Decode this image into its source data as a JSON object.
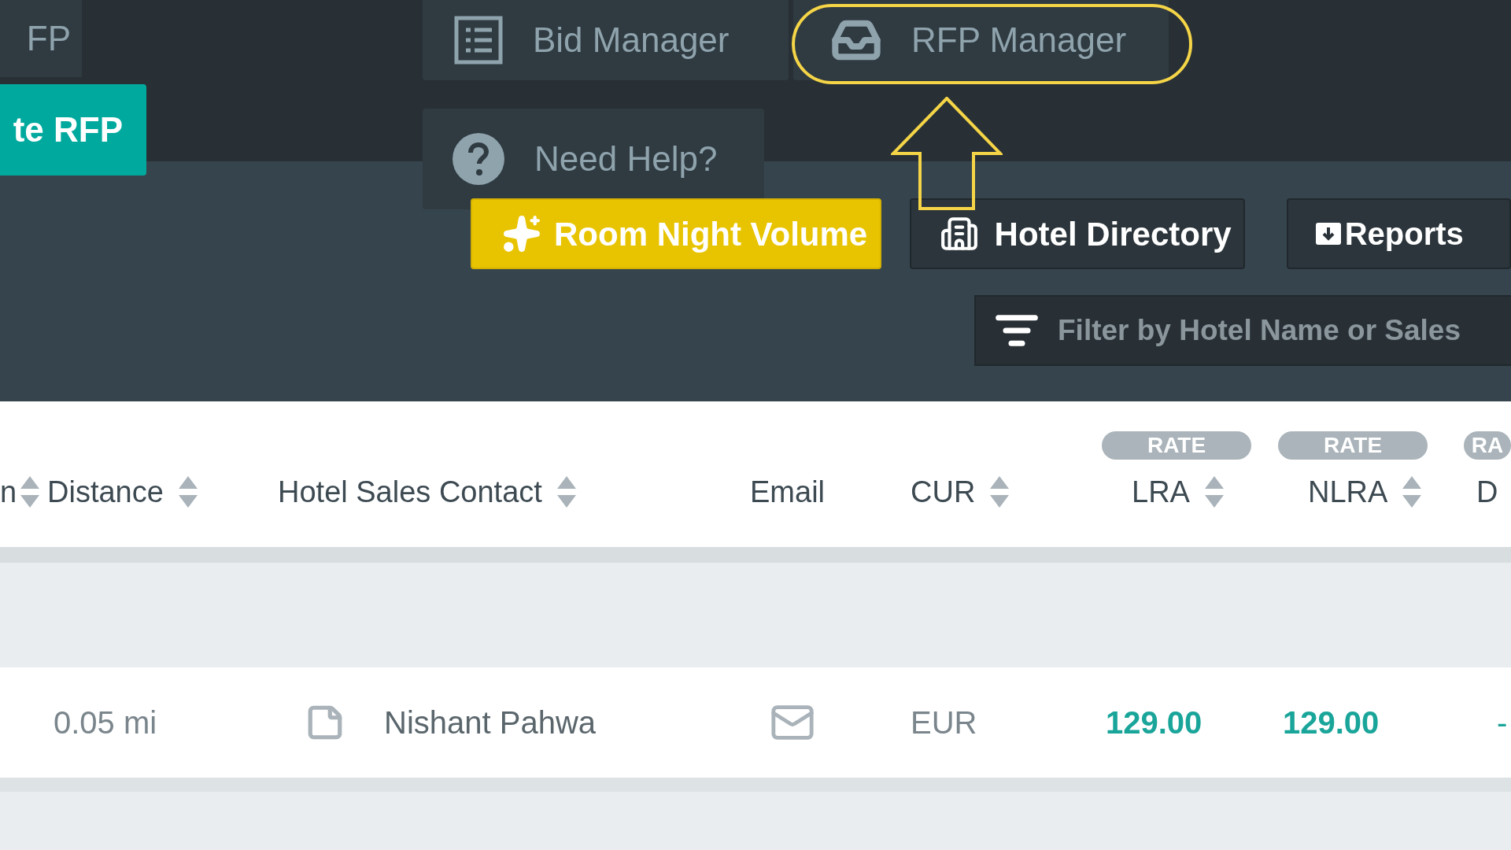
{
  "nav_tabs": [
    {
      "label": "FP",
      "kind": "plain"
    },
    {
      "label": "Bid Manager",
      "kind": "list"
    },
    {
      "label": "RFP Manager",
      "kind": "inbox"
    }
  ],
  "create_button": {
    "label": "te RFP"
  },
  "help_link": {
    "label": "Need Help?"
  },
  "toolbar_buttons": [
    {
      "label": "Room Night Volume",
      "kind": "highlight"
    },
    {
      "label": "Hotel Directory",
      "kind": "directory"
    },
    {
      "label": "Reports",
      "kind": "reports"
    }
  ],
  "filter": {
    "placeholder": "Filter by Hotel Name or Sales"
  },
  "table": {
    "columns": [
      {
        "label": "n",
        "sortable": true
      },
      {
        "label": "Distance",
        "sortable": true
      },
      {
        "label": "Hotel Sales Contact",
        "sortable": true
      },
      {
        "label": "Email",
        "sortable": false
      },
      {
        "label": "CUR",
        "sortable": true
      },
      {
        "label": "LRA",
        "sortable": true,
        "badge": "RATE"
      },
      {
        "label": "NLRA",
        "sortable": true,
        "badge": "RATE"
      },
      {
        "label": "D",
        "sortable": false,
        "badge": "RA"
      }
    ],
    "rows": [
      {
        "distance": "0.05 mi",
        "contact": "Nishant Pahwa",
        "currency": "EUR",
        "lra": "129.00",
        "nlra": "129.00",
        "column_8": "-"
      }
    ]
  }
}
